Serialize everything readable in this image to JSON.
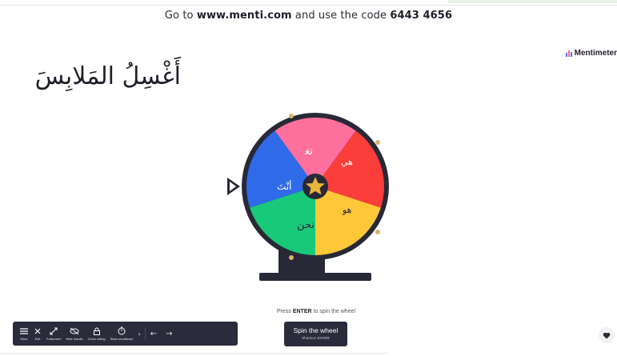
{
  "header": {
    "join_prefix": "Go to",
    "join_url": "www.menti.com",
    "join_middle": "and use the code",
    "join_code": "6443 4656"
  },
  "brand": {
    "name": "Mentimeter",
    "icon": "bar-logo-icon"
  },
  "slide": {
    "title": "أَغْسِلُ المَلابِسَ"
  },
  "wheel": {
    "segments": [
      {
        "label": "",
        "color": "#fd6f9d"
      },
      {
        "label": "",
        "color": "#fb3e3a"
      },
      {
        "label": "",
        "color": "#fec738"
      },
      {
        "label": "",
        "color": "#18c97a"
      },
      {
        "label": "أنْتَ",
        "color": "#2f6ae8"
      }
    ],
    "rim_color": "#272937",
    "hub_icon": "star-icon",
    "pointer_icon": "triangle-pointer-icon"
  },
  "spin": {
    "hint_prefix": "Press",
    "hint_key": "ENTER",
    "hint_suffix": "to spin the wheel",
    "button_label": "Spin the wheel",
    "button_shortcut": "Shortcut: ENTER"
  },
  "toolbar": {
    "items": [
      {
        "label": "More",
        "icon": "menu-icon"
      },
      {
        "label": "Exit",
        "icon": "close-icon"
      },
      {
        "label": "Fullscreen",
        "icon": "fullscreen-icon"
      },
      {
        "label": "Hide results",
        "icon": "eye-off-icon"
      },
      {
        "label": "Close voting",
        "icon": "lock-icon"
      },
      {
        "label": "Start countdown",
        "icon": "timer-icon"
      }
    ],
    "more": "›",
    "prev": "←",
    "next": "→"
  },
  "reaction": {
    "icon": "heart-icon"
  }
}
